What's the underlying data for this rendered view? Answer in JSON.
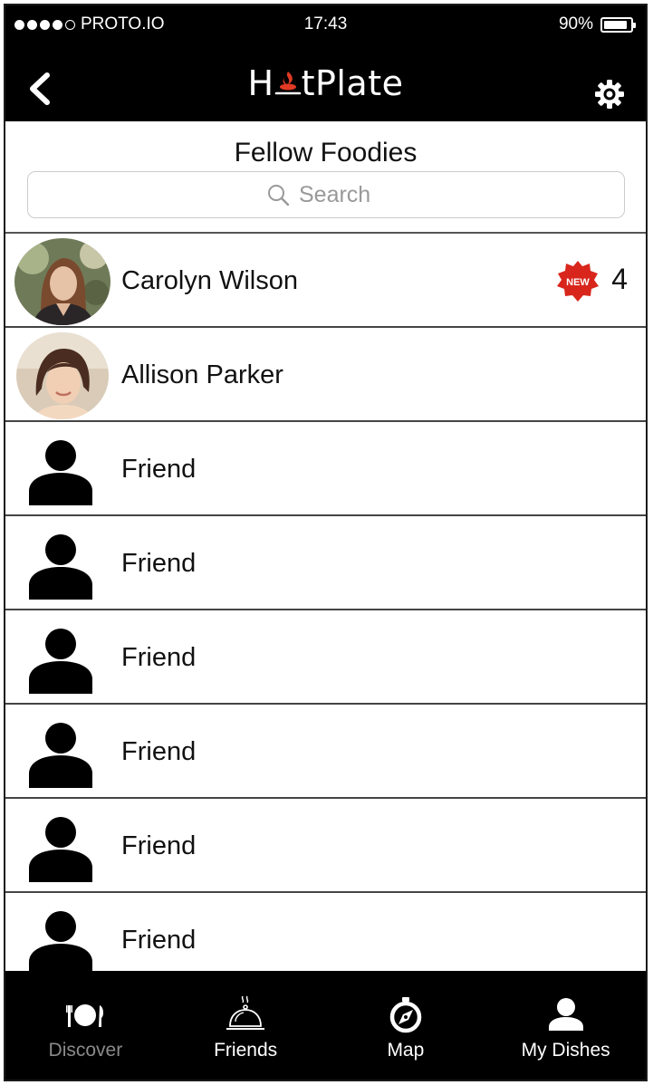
{
  "status_bar": {
    "carrier": "PROTO.IO",
    "time": "17:43",
    "battery_percent": "90%",
    "battery_level": 0.9,
    "signal_bars": 4,
    "signal_bars_total": 5
  },
  "nav": {
    "logo_prefix": "H",
    "logo_suffix": "tPlate",
    "logo_full": "HotPlate",
    "back_icon": "chevron-left-icon",
    "settings_icon": "gear-icon"
  },
  "page": {
    "title": "Fellow Foodies",
    "search_placeholder": "Search"
  },
  "friends": [
    {
      "name": "Carolyn Wilson",
      "avatar": "photo",
      "badge_label": "NEW",
      "badge_count": "4"
    },
    {
      "name": "Allison Parker",
      "avatar": "photo"
    },
    {
      "name": "Friend",
      "avatar": "person-icon"
    },
    {
      "name": "Friend",
      "avatar": "person-icon"
    },
    {
      "name": "Friend",
      "avatar": "person-icon"
    },
    {
      "name": "Friend",
      "avatar": "person-icon"
    },
    {
      "name": "Friend",
      "avatar": "person-icon"
    },
    {
      "name": "Friend",
      "avatar": "person-icon"
    }
  ],
  "tabs": [
    {
      "label": "Discover",
      "icon": "plate-fork-knife-icon",
      "state": "disabled"
    },
    {
      "label": "Friends",
      "icon": "cloche-icon",
      "state": "active"
    },
    {
      "label": "Map",
      "icon": "compass-icon",
      "state": "normal"
    },
    {
      "label": "My Dishes",
      "icon": "person-icon",
      "state": "normal"
    }
  ],
  "colors": {
    "bar_background": "#000000",
    "badge_red": "#d8261c",
    "logo_flame": "#e03a24",
    "disabled_tab": "#8a8a8a"
  }
}
